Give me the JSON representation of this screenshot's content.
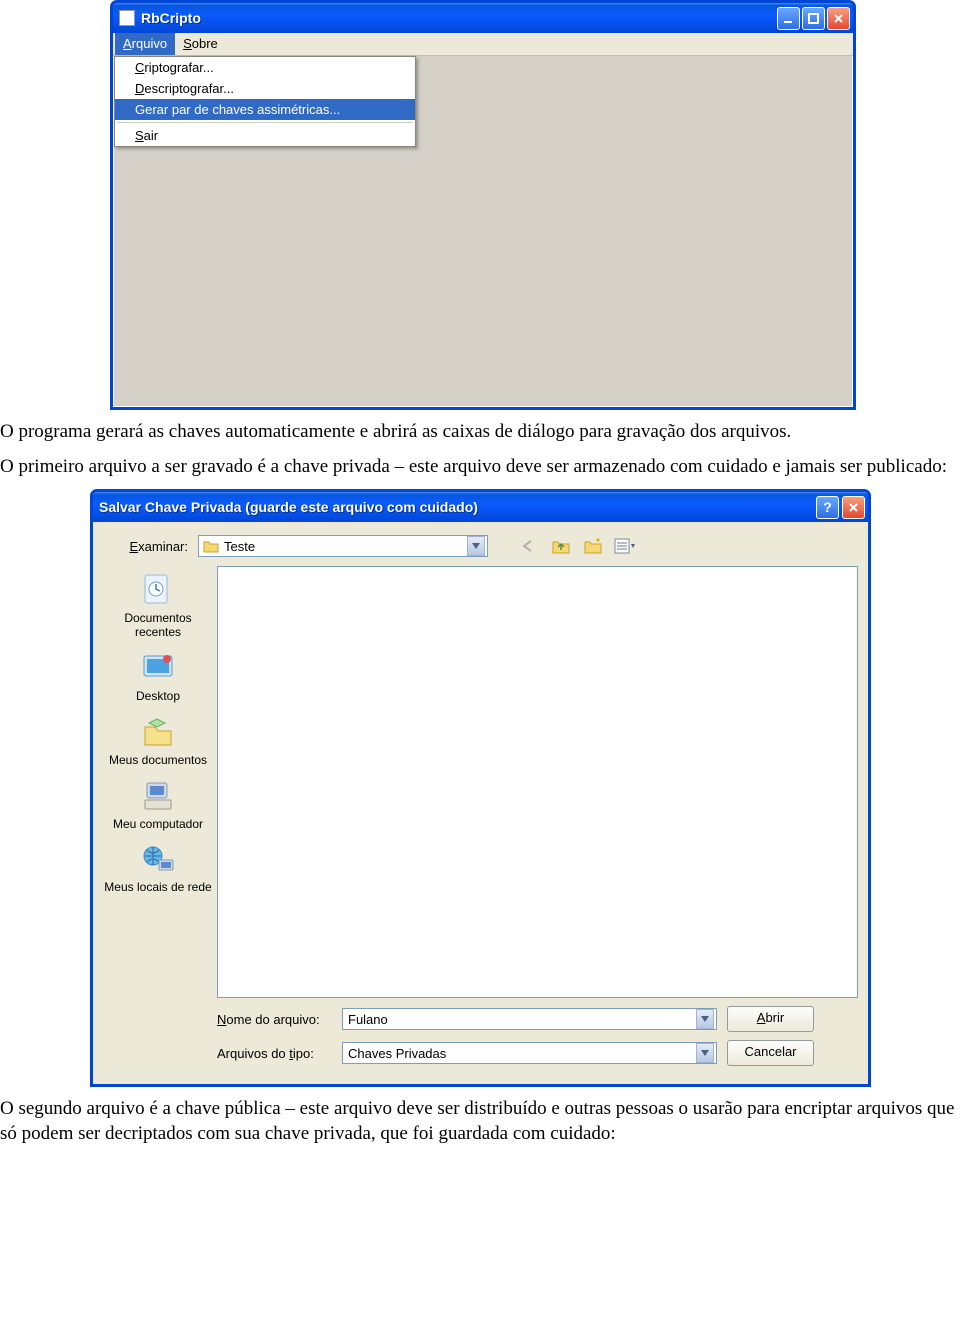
{
  "window1": {
    "title": "RbCripto",
    "menubar": {
      "arquivo": "Arquivo",
      "sobre": "Sobre"
    },
    "dropdown": {
      "item1": "Criptografar...",
      "item2": "Descriptografar...",
      "item3": "Gerar par de chaves assimétricas...",
      "item4": "Sair"
    }
  },
  "para1": "O programa gerará as chaves automaticamente e abrirá as caixas de diálogo para gravação dos arquivos.",
  "para2": "O primeiro arquivo a ser gravado é a chave privada – este arquivo deve ser armazenado com cuidado e jamais ser publicado:",
  "dialog": {
    "title": "Salvar Chave Privada (guarde este arquivo com cuidado)",
    "examinar_label": "Examinar:",
    "folder_name": "Teste",
    "places": {
      "p1": "Documentos recentes",
      "p2": "Desktop",
      "p3": "Meus documentos",
      "p4": "Meu computador",
      "p5": "Meus locais de rede"
    },
    "filename_label": "Nome do arquivo:",
    "filename_value": "Fulano",
    "filetype_label": "Arquivos do tipo:",
    "filetype_value": "Chaves Privadas",
    "open_btn": "Abrir",
    "cancel_btn": "Cancelar"
  },
  "para3": "O segundo arquivo é a chave pública – este arquivo deve ser distribuído e outras pessoas o usarão para encriptar arquivos que só podem ser decriptados com sua chave privada, que foi guardada com cuidado:"
}
